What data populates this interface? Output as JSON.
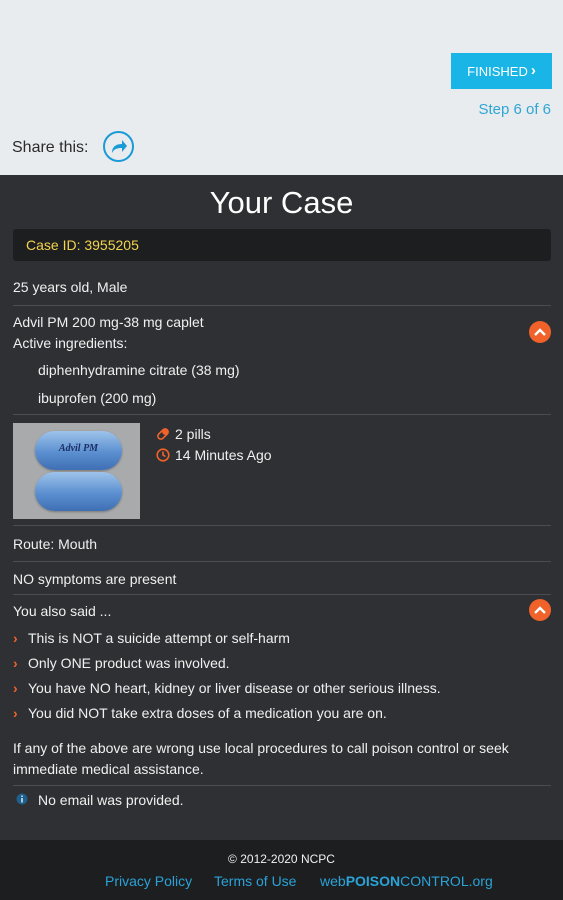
{
  "header": {
    "finish_label": "FINISHED",
    "step_text": "Step 6 of 6",
    "share_label": "Share this:"
  },
  "case": {
    "title": "Your Case",
    "case_id": "Case ID: 3955205",
    "patient": "25 years old, Male",
    "product": "Advil PM 200 mg-38 mg caplet",
    "active_ingredients_label": "Active ingredients:",
    "ingredients": [
      "diphenhydramine citrate (38 mg)",
      "ibuprofen (200 mg)"
    ],
    "pill_imprint": "Advil PM",
    "amount": "2 pills",
    "time_ago": "14 Minutes Ago",
    "route": "Route: Mouth",
    "symptoms": "NO symptoms are present",
    "also_said_label": "You also said ...",
    "statements": [
      "This is NOT a suicide attempt or self-harm",
      "Only ONE product was involved.",
      "You have NO heart, kidney or liver disease or other serious illness.",
      "You did NOT take extra doses of a medication you are on."
    ],
    "warning_line1": "If any of the above are wrong use local procedures to call poison control or seek",
    "warning_line2": "immediate medical assistance.",
    "email_note": "No email was provided."
  },
  "footer": {
    "copyright": "© 2012-2020 NCPC",
    "links": [
      "Privacy Policy",
      "Terms of Use"
    ],
    "brand_prefix": "web",
    "brand_bold": "POISON",
    "brand_suffix": "CONTROL.org"
  },
  "colors": {
    "accent_blue": "#19b5e6",
    "orange": "#f0622a",
    "case_id_yellow": "#f3d44e",
    "card_bg": "#2e3033"
  },
  "icons": {
    "share": "share-arrow-icon",
    "pill": "pill-icon",
    "clock": "clock-icon",
    "collapse": "chevron-up-icon",
    "bullet": "chevron-right-icon",
    "info": "info-icon"
  }
}
